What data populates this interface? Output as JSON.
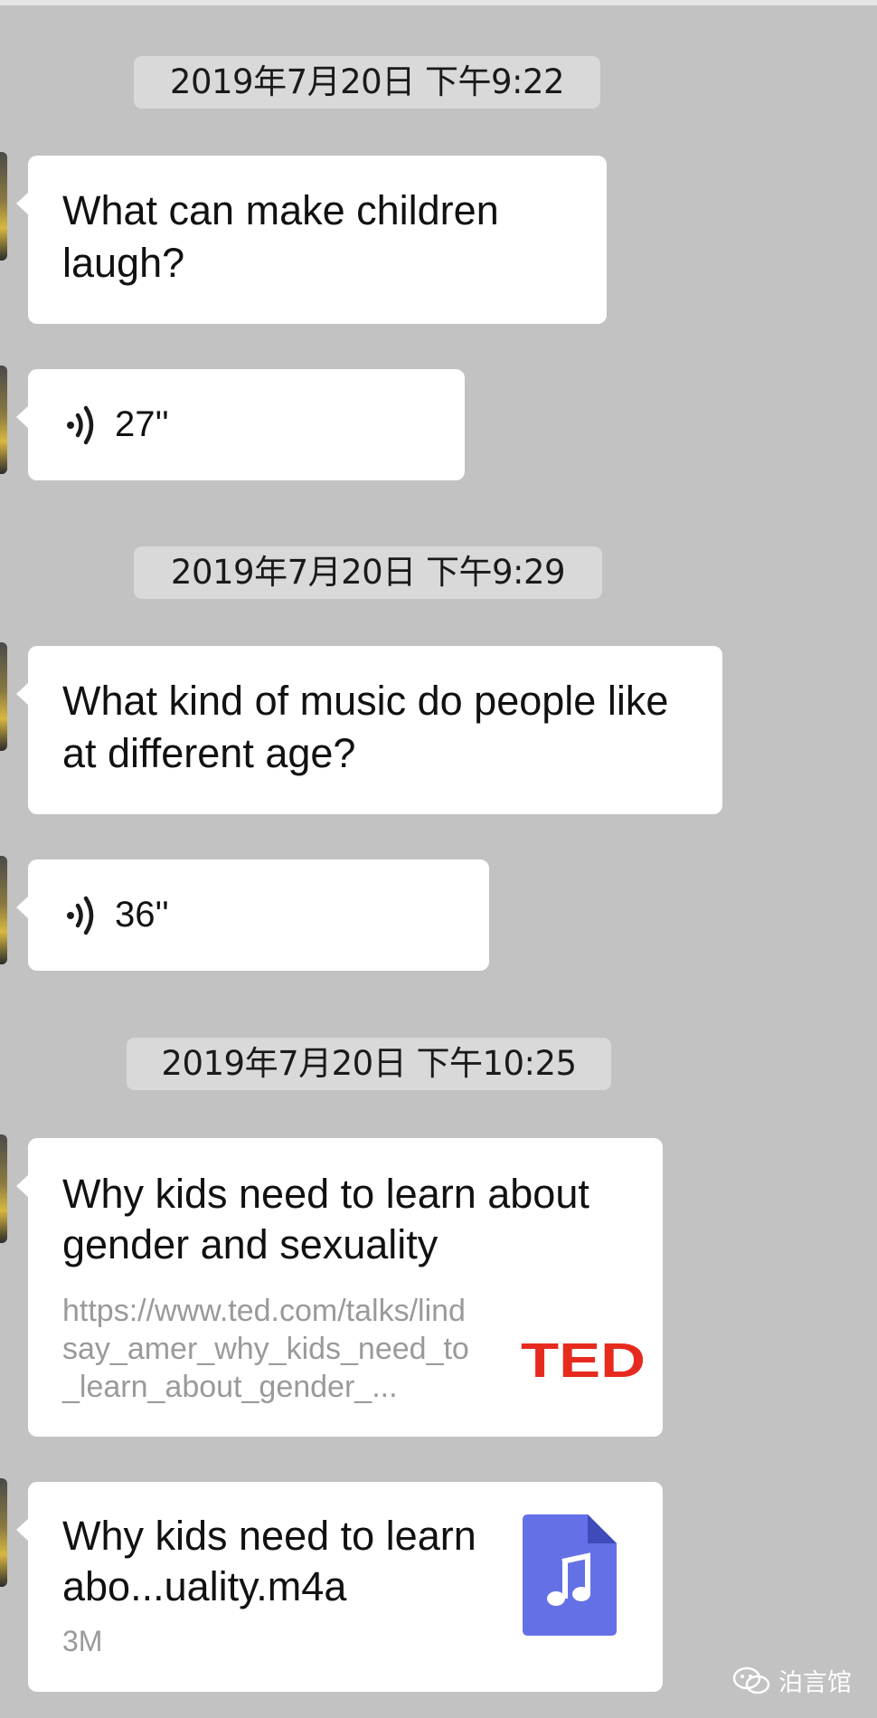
{
  "chat": {
    "timestamps": [
      "2019年7月20日 下午9:22",
      "2019年7月20日 下午9:29",
      "2019年7月20日 下午10:25"
    ],
    "messages": [
      {
        "type": "text",
        "text": "What can make children laugh?"
      },
      {
        "type": "voice",
        "duration": "27''",
        "icon": "voice-wave-icon"
      },
      {
        "type": "text",
        "text": "What kind of music do people like at different age?"
      },
      {
        "type": "voice",
        "duration": "36''",
        "icon": "voice-wave-icon"
      },
      {
        "type": "link",
        "title": "Why kids need to learn about gender and sexuality",
        "url": "https://www.ted.com/talks/lindsay_amer_why_kids_need_to_learn_about_gender_...",
        "source_logo": "TED",
        "logo_color": "#e62b1e"
      },
      {
        "type": "file",
        "title": "Why kids need to learn abo...uality.m4a",
        "size": "3M",
        "icon": "music-file-icon",
        "icon_color": "#6471e6"
      }
    ]
  },
  "watermark": {
    "text": "泊言馆",
    "icon": "wechat-icon"
  },
  "colors": {
    "background": "#c2c2c2",
    "bubble": "#ffffff",
    "timestamp_bg": "#d9d9d9"
  }
}
